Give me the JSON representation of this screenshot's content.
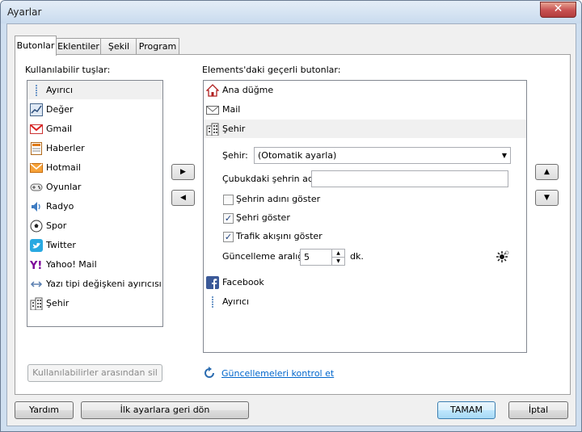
{
  "window": {
    "title": "Ayarlar",
    "close_symbol": "✕"
  },
  "tabs": [
    "Butonlar",
    "Eklentiler",
    "Şekil",
    "Program"
  ],
  "left": {
    "label": "Kullanılabilir tuşlar:",
    "items": [
      {
        "label": "Ayırıcı",
        "icon": "separator-icon"
      },
      {
        "label": "Değer",
        "icon": "chart-icon"
      },
      {
        "label": "Gmail",
        "icon": "gmail-icon"
      },
      {
        "label": "Haberler",
        "icon": "news-icon"
      },
      {
        "label": "Hotmail",
        "icon": "hotmail-icon"
      },
      {
        "label": "Oyunlar",
        "icon": "gamepad-icon"
      },
      {
        "label": "Radyo",
        "icon": "speaker-icon"
      },
      {
        "label": "Spor",
        "icon": "soccer-ball-icon"
      },
      {
        "label": "Twitter",
        "icon": "twitter-icon"
      },
      {
        "label": "Yahoo! Mail",
        "icon": "yahoo-icon"
      },
      {
        "label": "Yazı tipi değişkeni ayırıcısı",
        "icon": "font-separator-icon"
      },
      {
        "label": "Şehir",
        "icon": "city-icon"
      }
    ],
    "remove_button": "Kullanılabilirler arasından sil"
  },
  "move_right_symbol": "▶",
  "move_left_symbol": "◀",
  "move_up_symbol": "▲",
  "move_down_symbol": "▼",
  "right": {
    "label": "Elements'daki geçerli butonlar:",
    "items": [
      {
        "label": "Ana düğme",
        "icon": "home-icon"
      },
      {
        "label": "Mail",
        "icon": "mail-icon"
      },
      {
        "label": "Şehir",
        "icon": "city-icon"
      }
    ],
    "city_settings": {
      "city_label": "Şehir:",
      "city_value": "(Otomatik ayarla)",
      "bar_name_label": "Çubukdaki şehrin adı:",
      "bar_name_value": "",
      "show_name_label": "Şehrin adını göster",
      "show_name_checked": false,
      "show_city_label": "Şehri göster",
      "show_city_checked": true,
      "show_traffic_label": "Trafik akışını göster",
      "show_traffic_checked": true,
      "interval_label": "Güncelleme aralığı:",
      "interval_value": "5",
      "interval_unit": "dk."
    },
    "items_after": [
      {
        "label": "Facebook",
        "icon": "facebook-icon"
      },
      {
        "label": "Ayırıcı",
        "icon": "separator-icon"
      }
    ]
  },
  "update_link": "Güncellemeleri kontrol et",
  "footer": {
    "help": "Yardım",
    "reset": "İlk ayarlara geri dön",
    "ok": "TAMAM",
    "cancel": "İptal"
  }
}
